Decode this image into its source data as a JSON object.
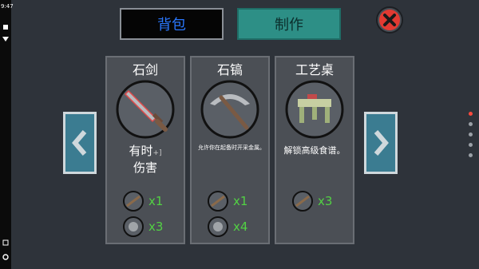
{
  "status": {
    "time": "9:47"
  },
  "tabs": {
    "backpack": "背包",
    "craft": "制作"
  },
  "recipes": [
    {
      "name": "石剑",
      "desc_main": "有时",
      "desc_sup": "+]",
      "desc_line2": "伤害",
      "materials": [
        {
          "qty": "x1"
        },
        {
          "qty": "x3"
        }
      ]
    },
    {
      "name": "石镐",
      "desc": "允许你在起备时开采金属。",
      "materials": [
        {
          "qty": "x1"
        },
        {
          "qty": "x4"
        }
      ]
    },
    {
      "name": "工艺桌",
      "desc": "解锁高级食谱。",
      "materials": [
        {
          "qty": "x3"
        }
      ]
    }
  ],
  "colors": {
    "accent_green": "#52d144",
    "tab_active": "#2d8f86",
    "tab_inactive_text": "#2a78ff",
    "pager_active": "#ff4a3d"
  },
  "icons": {
    "close": "close-icon",
    "left": "chevron-left-icon",
    "right": "chevron-right-icon"
  }
}
